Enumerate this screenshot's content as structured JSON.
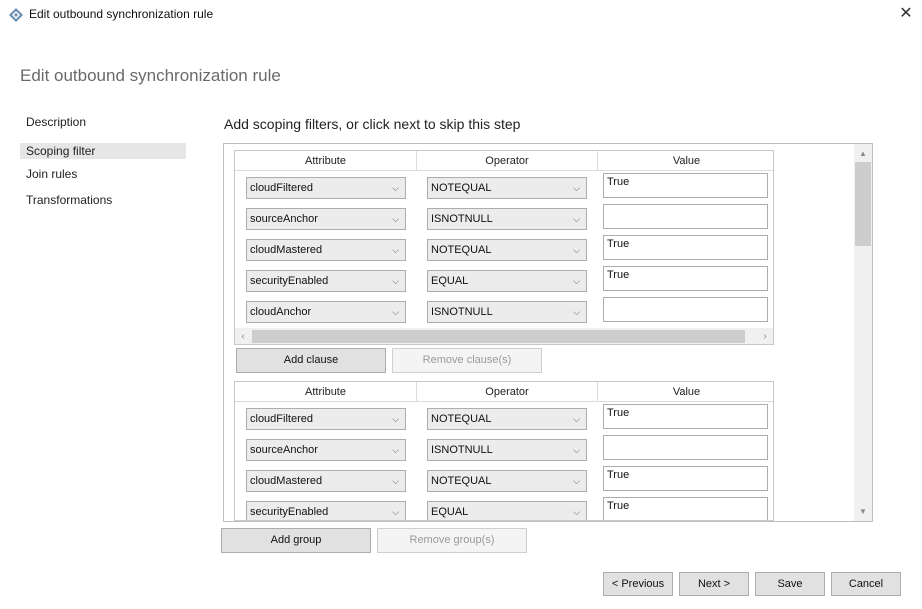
{
  "window": {
    "title": "Edit outbound synchronization rule",
    "close_glyph": "✕"
  },
  "page": {
    "heading": "Edit outbound synchronization rule",
    "step_heading": "Add scoping filters, or click next to skip this step"
  },
  "nav": {
    "items": [
      {
        "label": "Description"
      },
      {
        "label": "Scoping filter",
        "selected": true
      },
      {
        "label": "Join rules"
      },
      {
        "label": "Transformations"
      }
    ]
  },
  "table_headers": {
    "attribute": "Attribute",
    "operator": "Operator",
    "value": "Value"
  },
  "groups": [
    {
      "clauses": [
        {
          "attribute": "cloudFiltered",
          "operator": "NOTEQUAL",
          "value": "True"
        },
        {
          "attribute": "sourceAnchor",
          "operator": "ISNOTNULL",
          "value": ""
        },
        {
          "attribute": "cloudMastered",
          "operator": "NOTEQUAL",
          "value": "True"
        },
        {
          "attribute": "securityEnabled",
          "operator": "EQUAL",
          "value": "True"
        },
        {
          "attribute": "cloudAnchor",
          "operator": "ISNOTNULL",
          "value": ""
        }
      ],
      "add_clause_label": "Add clause",
      "remove_clause_label": "Remove clause(s)"
    },
    {
      "clauses": [
        {
          "attribute": "cloudFiltered",
          "operator": "NOTEQUAL",
          "value": "True"
        },
        {
          "attribute": "sourceAnchor",
          "operator": "ISNOTNULL",
          "value": ""
        },
        {
          "attribute": "cloudMastered",
          "operator": "NOTEQUAL",
          "value": "True"
        },
        {
          "attribute": "securityEnabled",
          "operator": "EQUAL",
          "value": "True"
        }
      ]
    }
  ],
  "icons": {
    "dropdown": "chevron-down-icon",
    "app": "sync-diamond-icon"
  },
  "buttons": {
    "add_group": "Add group",
    "remove_group": "Remove group(s)",
    "previous": "< Previous",
    "next": "Next >",
    "save": "Save",
    "cancel": "Cancel"
  }
}
